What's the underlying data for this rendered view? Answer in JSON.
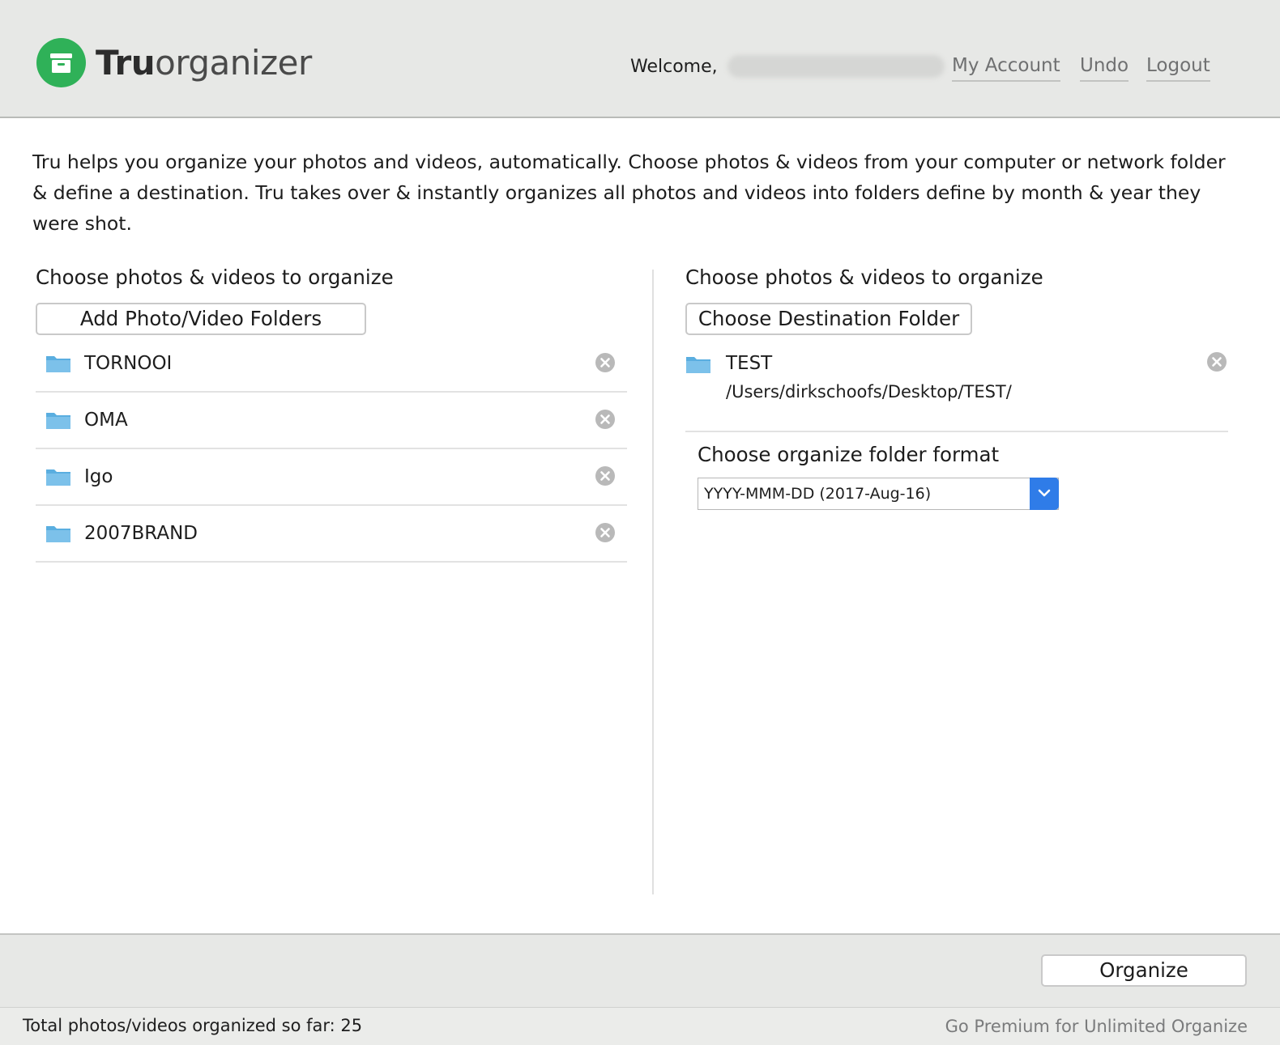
{
  "header": {
    "app_name_bold": "Tru",
    "app_name_light": "organizer",
    "welcome_label": "Welcome,",
    "nav": {
      "my_account": "My Account",
      "undo": "Undo",
      "logout": "Logout"
    }
  },
  "intro_text": "Tru helps you organize your photos and videos, automatically. Choose photos & videos from your computer or network folder & define a destination. Tru takes over & instantly organizes all photos and videos into folders define by month & year they were shot.",
  "source_panel": {
    "title": "Choose photos & videos to organize",
    "add_button_label": "Add Photo/Video Folders",
    "folders": [
      {
        "name": "TORNOOI",
        "icon": "folder-icon"
      },
      {
        "name": "OMA",
        "icon": "folder-icon"
      },
      {
        "name": "Igo",
        "icon": "folder-icon"
      },
      {
        "name": "2007BRAND",
        "icon": "folder-icon"
      }
    ]
  },
  "destination_panel": {
    "title": "Choose photos & videos to organize",
    "choose_button_label": "Choose Destination Folder",
    "destination": {
      "name": "TEST",
      "path": "/Users/dirkschoofs/Desktop/TEST/"
    },
    "format_label": "Choose organize folder format",
    "format_selected": "YYYY-MMM-DD (2017-Aug-16)"
  },
  "footer": {
    "organize_button_label": "Organize",
    "total_label": "Total photos/videos organized so far: 25",
    "premium_link": "Go Premium for Unlimited Organize"
  },
  "colors": {
    "brand_green": "#2fb158",
    "header_bg": "#e7e8e6",
    "select_arrow_blue": "#2f7ce8",
    "folder_blue": "#5aaee0"
  }
}
